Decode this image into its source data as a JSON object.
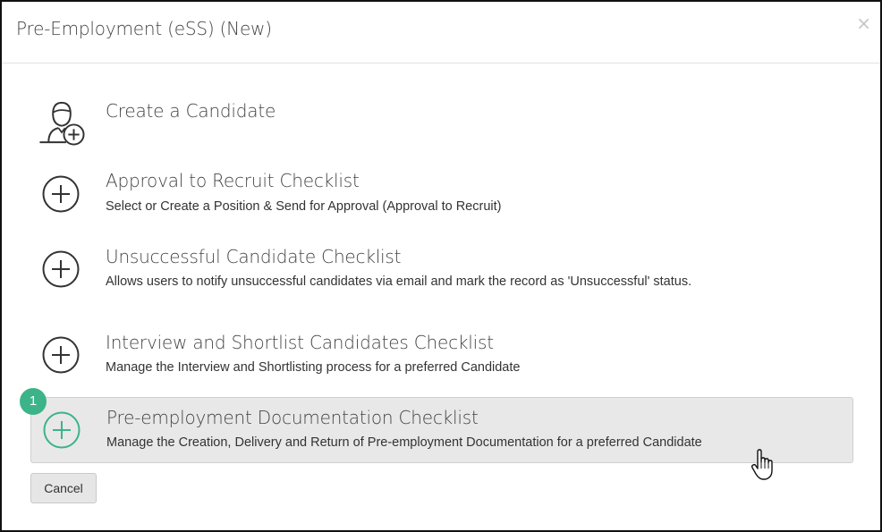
{
  "dialog": {
    "title": "Pre-Employment (eSS) (New)",
    "close_glyph": "×"
  },
  "options": [
    {
      "label": "Create a Candidate",
      "description": "",
      "icon": "add-user-icon"
    },
    {
      "label": "Approval to Recruit Checklist",
      "description": "Select or Create a Position & Send for Approval (Approval to Recruit)",
      "icon": "plus-circle-icon"
    },
    {
      "label": "Unsuccessful Candidate Checklist",
      "description": "Allows users to notify unsuccessful candidates via email and mark the record as 'Unsuccessful' status.",
      "icon": "plus-circle-icon"
    },
    {
      "label": "Interview and Shortlist Candidates Checklist",
      "description": "Manage the Interview and Shortlisting process for a preferred Candidate",
      "icon": "plus-circle-icon"
    },
    {
      "label": "Pre-employment Documentation Checklist",
      "description": "Manage the Creation, Delivery and Return of Pre-employment Documentation for a preferred Candidate",
      "icon": "plus-circle-icon"
    }
  ],
  "step_badge": "1",
  "footer": {
    "cancel_label": "Cancel"
  },
  "colors": {
    "accent": "#3db38a",
    "highlight": "#e8e8e8",
    "icon_stroke": "#333333"
  }
}
